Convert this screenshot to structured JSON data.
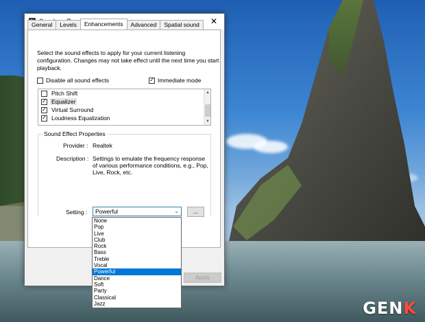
{
  "window": {
    "title": "Speakers Properties",
    "close_glyph": "✕"
  },
  "tabs": [
    {
      "label": "General",
      "active": false
    },
    {
      "label": "Levels",
      "active": false
    },
    {
      "label": "Enhancements",
      "active": true
    },
    {
      "label": "Advanced",
      "active": false
    },
    {
      "label": "Spatial sound",
      "active": false
    }
  ],
  "enhancements": {
    "intro_text": "Select the sound effects to apply for your current listening configuration. Changes may not take effect until the next time you start playback.",
    "disable_all": {
      "label": "Disable all sound effects",
      "checked": false
    },
    "immediate_mode": {
      "label": "Immediate mode",
      "checked": true
    },
    "effects": [
      {
        "label": "Pitch Shift",
        "checked": false,
        "selected": false
      },
      {
        "label": "Equalizer",
        "checked": true,
        "selected": true
      },
      {
        "label": "Virtual Surround",
        "checked": true,
        "selected": false
      },
      {
        "label": "Loudness Equalization",
        "checked": true,
        "selected": false
      }
    ],
    "properties": {
      "group_title": "Sound Effect Properties",
      "provider_label": "Provider :",
      "provider_value": "Realtek",
      "description_label": "Description :",
      "description_value": "Settings to emulate the frequency response of various performance conditions,  e.g., Pop, Live, Rock, etc.",
      "setting_label": "Setting :",
      "setting_value": "Powerful",
      "more_button": "...",
      "dropdown_options": [
        "None",
        "Pop",
        "Live",
        "Club",
        "Rock",
        "Bass",
        "Treble",
        "Vocal",
        "Powerful",
        "Dance",
        "Soft",
        "Party",
        "Classical",
        "Jazz"
      ],
      "dropdown_selected": "Powerful"
    }
  },
  "footer": {
    "apply_label": "Apply"
  },
  "watermark": {
    "text_main": "GEN",
    "text_accent": "K"
  },
  "icons": {
    "window_icon": "speaker-icon",
    "close": "close-icon",
    "dropdown": "chevron-down-icon",
    "scroll_up": "scroll-up-arrow-icon",
    "scroll_down": "scroll-down-arrow-icon"
  },
  "colors": {
    "accent": "#0078d7",
    "focus_border": "#3c7fb1",
    "watermark_accent": "#ff4a3a"
  }
}
